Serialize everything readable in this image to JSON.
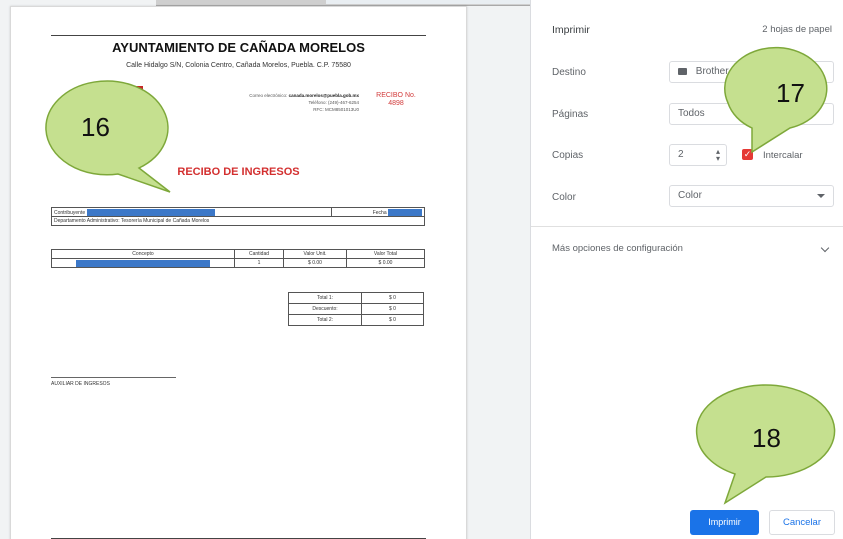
{
  "document": {
    "title": "AYUNTAMIENTO DE CAÑADA MORELOS",
    "address": "Calle Hidalgo S/N, Colonia Centro, Cañada Morelos, Puebla. C.P. 75580",
    "contact": {
      "email_label": "Correo electrónico:",
      "email": "canada.morelos@puebla.gob.mx",
      "phone": "Teléfono: (249)-467-6254",
      "rfc": "RFC: MCM8501013U0"
    },
    "receipt_label": "RECIBO No.",
    "receipt_number": "4898",
    "receipt_title": "RECIBO DE INGRESOS",
    "taxpayer_label": "Contribuyente",
    "date_label": "Fecha",
    "department": "Departamento Administrativo: Tesorería Municipal de Cañada Morelos",
    "items_table": {
      "headers": [
        "Concepto",
        "Cantidad",
        "Valor Unit.",
        "Valor Total"
      ],
      "rows": [
        [
          "",
          "1",
          "$ 0.00",
          "$ 0.00"
        ]
      ]
    },
    "totals": [
      {
        "label": "Total 1:",
        "value": "$ 0"
      },
      {
        "label": "Descuento:",
        "value": "$ 0"
      },
      {
        "label": "Total 2:",
        "value": "$ 0"
      }
    ],
    "signature_label": "AUXILIAR DE INGRESOS"
  },
  "print_panel": {
    "title": "Imprimir",
    "sheets_count": "2 hojas de papel",
    "destination": {
      "label": "Destino",
      "value": "Brother"
    },
    "pages": {
      "label": "Páginas",
      "value": "Todos"
    },
    "copies": {
      "label": "Copias",
      "value": "2"
    },
    "collate": {
      "label": "Intercalar",
      "checked": true
    },
    "color": {
      "label": "Color",
      "value": "Color"
    },
    "more_settings": "Más opciones de configuración",
    "print_button": "Imprimir",
    "cancel_button": "Cancelar"
  },
  "callouts": [
    "16",
    "17",
    "18"
  ],
  "colors": {
    "callout_fill": "#c5e08f",
    "callout_stroke": "#7ea83a",
    "accent_blue": "#1a73e8",
    "receipt_red": "#d32f2f",
    "redaction_blue": "#3c78c8"
  }
}
